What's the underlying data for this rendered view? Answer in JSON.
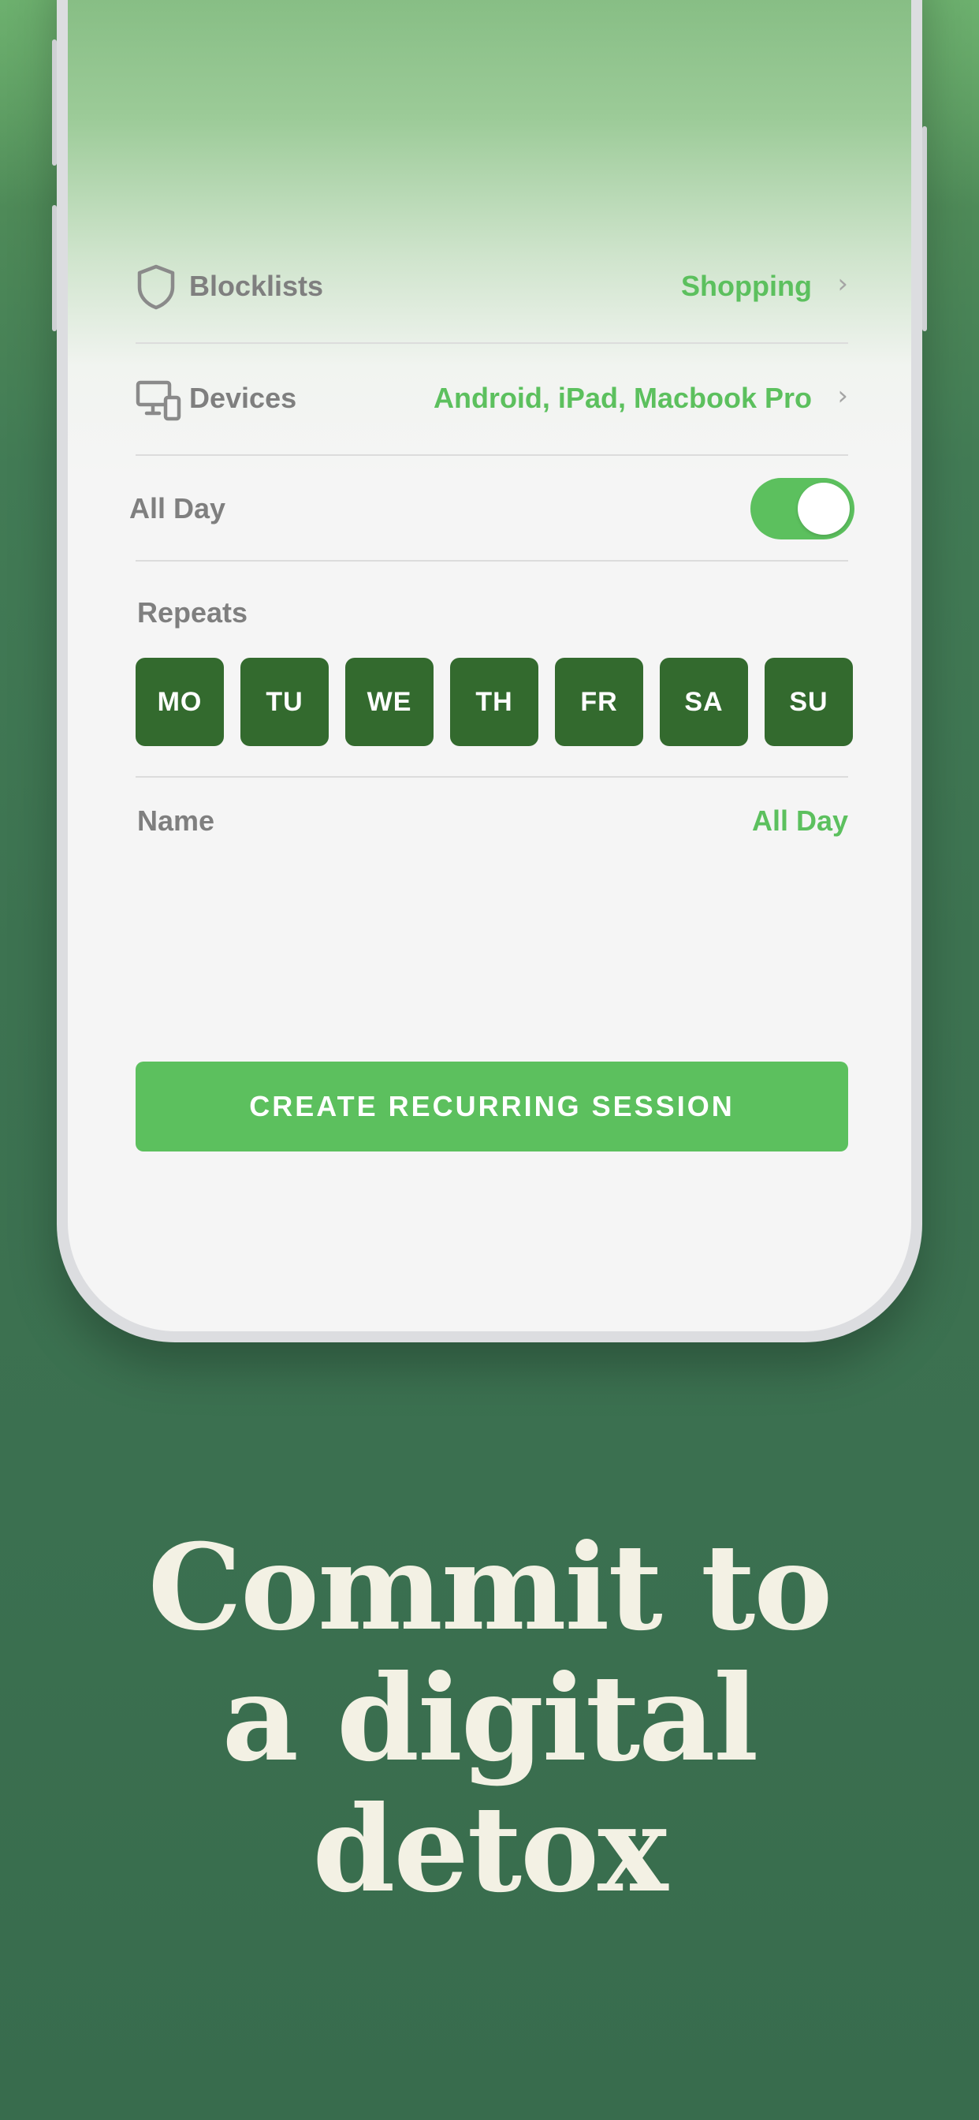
{
  "settings": {
    "blocklists": {
      "label": "Blocklists",
      "value": "Shopping",
      "icon": "shield-icon"
    },
    "devices": {
      "label": "Devices",
      "value": "Android, iPad, Macbook Pro",
      "icon": "devices-icon"
    },
    "all_day": {
      "label": "All Day",
      "enabled": true
    },
    "repeats": {
      "label": "Repeats",
      "days": [
        "MO",
        "TU",
        "WE",
        "TH",
        "FR",
        "SA",
        "SU"
      ]
    },
    "name": {
      "label": "Name",
      "value": "All Day"
    },
    "chevron": "›"
  },
  "cta": {
    "label": "CREATE RECURRING SESSION"
  },
  "headline": {
    "lines": [
      "Commit to",
      "a digital",
      "detox"
    ]
  },
  "colors": {
    "accent": "#5cc05e",
    "day_selected": "#336a2e",
    "background": "#3d7351",
    "headline": "#f3f1e4"
  }
}
